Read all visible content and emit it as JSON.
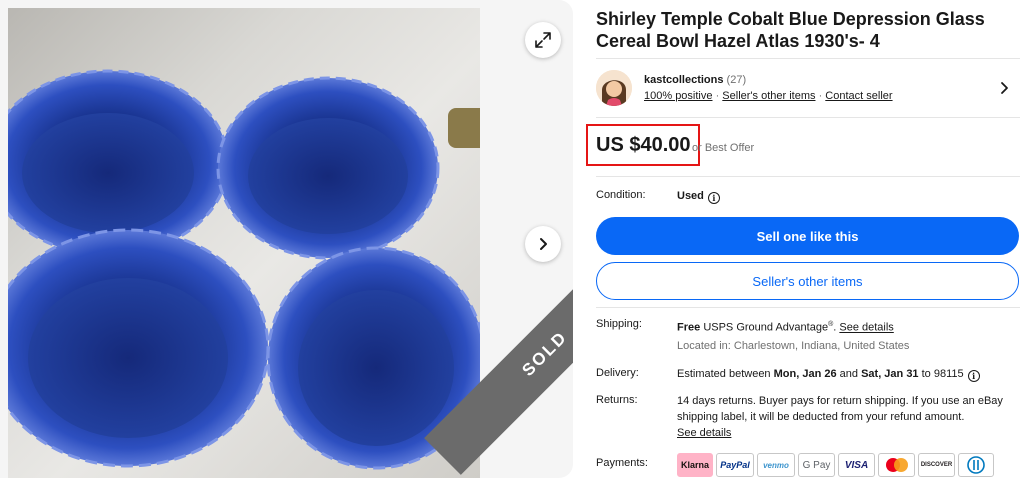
{
  "listing": {
    "title": "Shirley Temple Cobalt Blue Depression Glass Cereal Bowl Hazel Atlas 1930's- 4",
    "sold_label": "SOLD"
  },
  "seller": {
    "name": "kastcollections",
    "feedback_count": "(27)",
    "positive": "100% positive",
    "other_items_link": "Seller's other items",
    "contact_link": "Contact seller",
    "separator": "·"
  },
  "price": {
    "amount": "US $40.00",
    "best_offer": "or Best Offer"
  },
  "condition": {
    "label": "Condition:",
    "value": "Used"
  },
  "actions": {
    "sell_one_like_this": "Sell one like this",
    "sellers_other_items": "Seller's other items"
  },
  "shipping": {
    "label": "Shipping:",
    "free": "Free",
    "service": "USPS Ground Advantage",
    "reg_mark": "®",
    "details_link": "See details",
    "location": "Located in: Charlestown, Indiana, United States"
  },
  "delivery": {
    "label": "Delivery:",
    "prefix": "Estimated between",
    "start": "Mon, Jan 26",
    "and": "and",
    "end": "Sat, Jan 31",
    "to": "to 98115"
  },
  "returns": {
    "label": "Returns:",
    "line1": "14 days returns. Buyer pays for return shipping. If you use an eBay",
    "line2": "shipping label, it will be deducted from your refund amount.",
    "details_link": "See details"
  },
  "payments": {
    "label": "Payments:",
    "methods": [
      "Klarna",
      "PayPal",
      "venmo",
      "G Pay",
      "VISA",
      "Mastercard",
      "DISCOVER",
      "Diners Club"
    ]
  },
  "colors": {
    "primary_blue": "#0968f6",
    "highlight_red": "#e51515",
    "sold_band": "#6b6b6b"
  }
}
